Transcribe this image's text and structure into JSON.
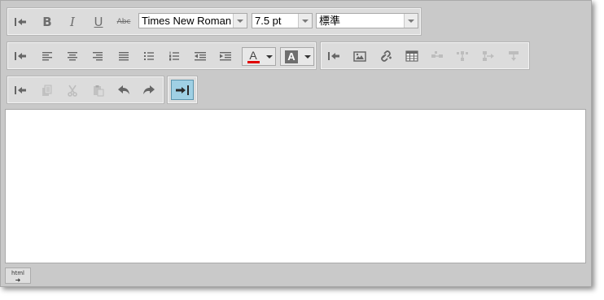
{
  "toolbar": {
    "font_name": "Times New Roman",
    "font_size": "7.5 pt",
    "paragraph_style": "標準",
    "bold_label": "B",
    "italic_label": "I",
    "underline_label": "U",
    "strike_label": "Abc",
    "font_color_label": "A",
    "highlight_color_label": "A",
    "font_color": "#e00000"
  },
  "footer": {
    "html_mode_label": "html",
    "html_mode_arrow": "➜"
  },
  "icons": [
    "collapse-icon",
    "bold-icon",
    "italic-icon",
    "underline-icon",
    "strikethrough-icon",
    "align-left-icon",
    "align-center-icon",
    "align-right-icon",
    "justify-icon",
    "bulleted-list-icon",
    "numbered-list-icon",
    "outdent-icon",
    "indent-icon",
    "font-color-icon",
    "highlight-color-icon",
    "image-icon",
    "link-icon",
    "table-icon",
    "copy-icon",
    "cut-icon",
    "paste-icon",
    "undo-icon",
    "redo-icon",
    "toggle-toolbar-icon"
  ]
}
